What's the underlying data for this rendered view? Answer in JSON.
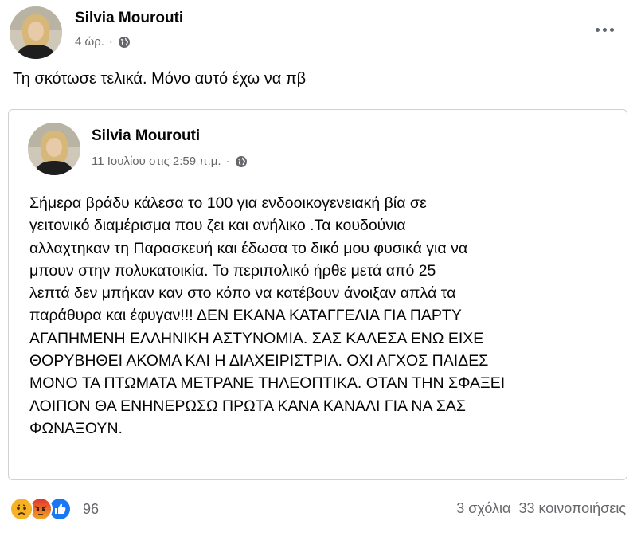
{
  "post": {
    "author": "Silvia Mourouti",
    "timestamp": "4 ώρ.",
    "separator": "·",
    "privacy_icon": "globe-icon",
    "text": "Τη σκότωσε τελικά. Μόνο αυτό έχω να πβ"
  },
  "shared_post": {
    "author": "Silvia Mourouti",
    "timestamp": "11 Ιουλίου στις 2:59 π.μ.",
    "separator": "·",
    "privacy_icon": "globe-icon",
    "body_lines": [
      "Σήμερα βράδυ κάλεσα το 100 για ενδοοικογενειακή βία σε",
      "γειτονικό διαμέρισμα που  ζει και ανήλικο .Τα κουδούνια",
      "αλλαχτηκαν τη Παρασκευή και έδωσα το δικό μου φυσικά για να",
      "μπουν στην πολυκατοικία. Το περιπολικό ήρθε μετά από 25",
      "λεπτά δεν μπήκαν καν στο κόπο να κατέβουν άνοιξαν απλά τα",
      "παράθυρα και έφυγαν!!! ΔΕΝ ΕΚΑΝΑ ΚΑΤΑΓΓΕΛΙΑ ΓΙΑ ΠΑΡΤΥ",
      "ΑΓΑΠΗΜΕΝΗ ΕΛΛΗΝΙΚΗ ΑΣΤΥΝΟΜΙΑ. ΣΑΣ ΚΑΛΕΣΑ ΕΝΩ ΕΙΧΕ",
      "ΘΟΡΥΒΗΘΕΙ ΑΚΟΜΑ ΚΑΙ Η ΔΙΑΧΕΙΡΙΣΤΡΙΑ. ΟΧΙ ΑΓΧΟΣ ΠΑΙΔΕΣ",
      "ΜΟΝΟ ΤΑ ΠΤΩΜΑΤΑ ΜΕΤΡΑΝΕ ΤΗΛΕΟΠΤΙΚΑ. ΟΤΑΝ ΤΗΝ ΣΦΑΞΕΙ",
      "ΛΟΙΠΟΝ ΘΑ ΕΝΗΝΕΡΩΣΩ ΠΡΩΤΑ ΚΑΝΑ ΚΑΝΑΛΙ ΓΙΑ ΝΑ ΣΑΣ",
      "ΦΩΝΑΞΟΥΝ."
    ]
  },
  "footer": {
    "reaction_icons": [
      "sad-icon",
      "angry-icon",
      "like-icon"
    ],
    "reaction_count": "96",
    "comments": "3 σχόλια",
    "shares": "33 κοινοποιήσεις"
  },
  "colors": {
    "text": "#050505",
    "secondary": "#65676b",
    "border": "#ced0d4",
    "like_blue": "#1877f2",
    "sad_yellow": "#f7b125",
    "angry_orange": "#e9710f"
  }
}
